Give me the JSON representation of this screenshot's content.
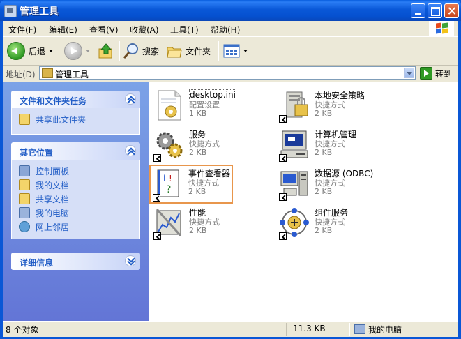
{
  "window": {
    "title": "管理工具"
  },
  "menu": [
    "文件(F)",
    "编辑(E)",
    "查看(V)",
    "收藏(A)",
    "工具(T)",
    "帮助(H)"
  ],
  "toolbar": {
    "back": "后退",
    "search": "搜索",
    "folders": "文件夹"
  },
  "address": {
    "label": "地址(D)",
    "value": "管理工具",
    "go": "转到"
  },
  "panels": {
    "tasks": {
      "title": "文件和文件夹任务",
      "items": [
        "共享此文件夹"
      ]
    },
    "places": {
      "title": "其它位置",
      "items": [
        "控制面板",
        "我的文档",
        "共享文档",
        "我的电脑",
        "网上邻居"
      ]
    },
    "details": {
      "title": "详细信息"
    }
  },
  "files": [
    {
      "name": "desktop.ini",
      "type": "配置设置",
      "size": "1 KB"
    },
    {
      "name": "本地安全策略",
      "type": "快捷方式",
      "size": "2 KB"
    },
    {
      "name": "服务",
      "type": "快捷方式",
      "size": "2 KB"
    },
    {
      "name": "计算机管理",
      "type": "快捷方式",
      "size": "2 KB"
    },
    {
      "name": "事件查看器",
      "type": "快捷方式",
      "size": "2 KB"
    },
    {
      "name": "数据源 (ODBC)",
      "type": "快捷方式",
      "size": "2 KB"
    },
    {
      "name": "性能",
      "type": "快捷方式",
      "size": "2 KB"
    },
    {
      "name": "组件服务",
      "type": "快捷方式",
      "size": "2 KB"
    }
  ],
  "status": {
    "count": "8 个对象",
    "size": "11.3 KB",
    "location": "我的电脑"
  },
  "colors": {
    "titlebar": "#0a58d8",
    "taskpane": "#6d8fe0",
    "link": "#215dc6",
    "highlight": "#e8964c"
  }
}
